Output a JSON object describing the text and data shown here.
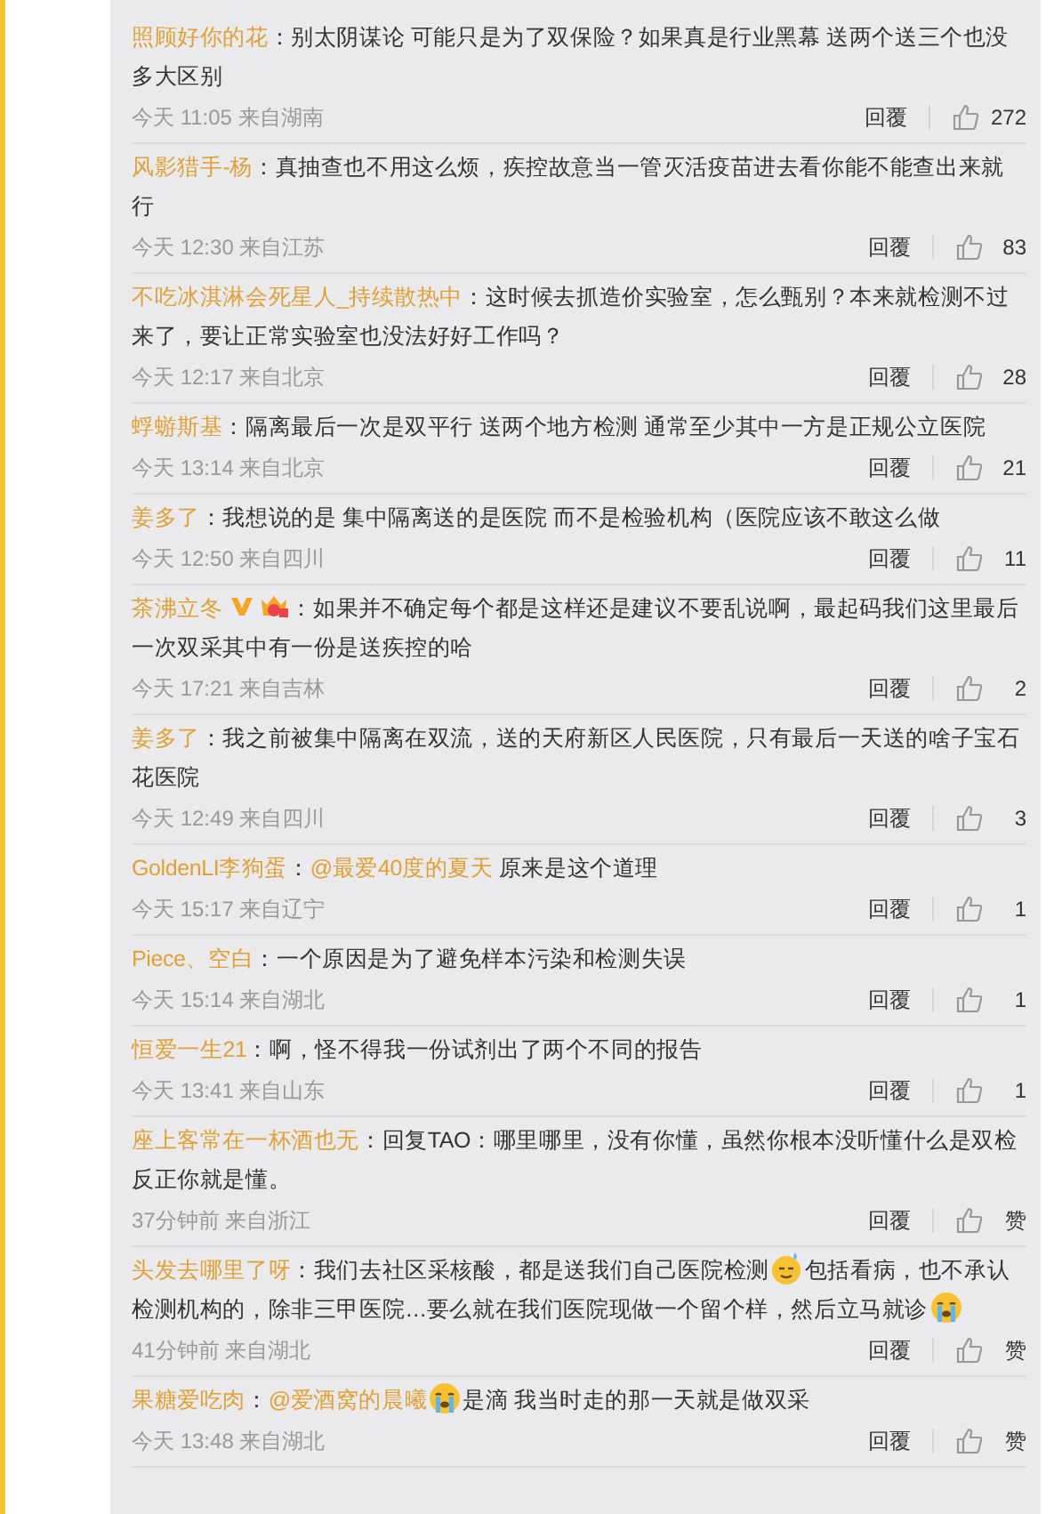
{
  "comments": [
    {
      "name": "照顾好你的花",
      "body": [
        {
          "kind": "text",
          "text": "：别太阴谋论 可能只是为了双保险？如果真是行业黑幕 送两个送三个也没多大区别"
        }
      ],
      "meta": "今天 11:05 来自湖南",
      "reply": "回覆",
      "likes": "272"
    },
    {
      "name": "风影猎手-杨",
      "body": [
        {
          "kind": "text",
          "text": "：真抽查也不用这么烦，疾控故意当一管灭活疫苗进去看你能不能查出来就行"
        }
      ],
      "meta": "今天 12:30 来自江苏",
      "reply": "回覆",
      "likes": "83"
    },
    {
      "name": "不吃冰淇淋会死星人_持续散热中",
      "body": [
        {
          "kind": "text",
          "text": "：这时候去抓造价实验室，怎么甄别？本来就检测不过来了，要让正常实验室也没法好好工作吗？"
        }
      ],
      "meta": "今天 12:17 来自北京",
      "reply": "回覆",
      "likes": "28"
    },
    {
      "name": "蜉蝣斯基",
      "body": [
        {
          "kind": "text",
          "text": "：隔离最后一次是双平行 送两个地方检测 通常至少其中一方是正规公立医院"
        }
      ],
      "meta": "今天 13:14 来自北京",
      "reply": "回覆",
      "likes": "21"
    },
    {
      "name": "姜多了",
      "body": [
        {
          "kind": "text",
          "text": "：我想说的是 集中隔离送的是医院 而不是检验机构（医院应该不敢这么做"
        }
      ],
      "meta": "今天 12:50 来自四川",
      "reply": "回覆",
      "likes": "11"
    },
    {
      "name": "茶沸立冬",
      "badges": [
        {
          "kind": "verified"
        },
        {
          "kind": "crown"
        }
      ],
      "body": [
        {
          "kind": "text",
          "text": "：如果并不确定每个都是这样还是建议不要乱说啊，最起码我们这里最后一次双采其中有一份是送疾控的哈"
        }
      ],
      "meta": "今天 17:21 来自吉林",
      "reply": "回覆",
      "likes": "2"
    },
    {
      "name": "姜多了",
      "body": [
        {
          "kind": "text",
          "text": "：我之前被集中隔离在双流，送的天府新区人民医院，只有最后一天送的啥子宝石花医院"
        }
      ],
      "meta": "今天 12:49 来自四川",
      "reply": "回覆",
      "likes": "3"
    },
    {
      "name": "GoldenLI李狗蛋",
      "body": [
        {
          "kind": "text",
          "text": "："
        },
        {
          "kind": "mention",
          "text": "@最爱40度的夏天"
        },
        {
          "kind": "text",
          "text": " 原来是这个道理"
        }
      ],
      "meta": "今天 15:17 来自辽宁",
      "reply": "回覆",
      "likes": "1"
    },
    {
      "name": "Piece、空白",
      "body": [
        {
          "kind": "text",
          "text": "：一个原因是为了避免样本污染和检测失误"
        }
      ],
      "meta": "今天 15:14 来自湖北",
      "reply": "回覆",
      "likes": "1"
    },
    {
      "name": "恒爱一生21",
      "body": [
        {
          "kind": "text",
          "text": "：啊，怪不得我一份试剂出了两个不同的报告"
        }
      ],
      "meta": "今天 13:41 来自山东",
      "reply": "回覆",
      "likes": "1"
    },
    {
      "name": "座上客常在一杯酒也无",
      "body": [
        {
          "kind": "text",
          "text": "：回复TAO：哪里哪里，没有你懂，虽然你根本没听懂什么是双检反正你就是懂。"
        }
      ],
      "meta": "37分钟前 来自浙江",
      "reply": "回覆",
      "likes": "赞"
    },
    {
      "name": "头发去哪里了呀",
      "body": [
        {
          "kind": "text",
          "text": "：我们去社区采核酸，都是送我们自己医院检测"
        },
        {
          "kind": "sweat_emoji"
        },
        {
          "kind": "text",
          "text": "包括看病，也不承认检测机构的，除非三甲医院…要么就在我们医院现做一个留个样，然后立马就诊"
        },
        {
          "kind": "crying_emoji"
        }
      ],
      "meta": "41分钟前 来自湖北",
      "reply": "回覆",
      "likes": "赞"
    },
    {
      "name": "果糖爱吃肉",
      "body": [
        {
          "kind": "text",
          "text": "："
        },
        {
          "kind": "mention",
          "text": "@爱酒窝的晨曦"
        },
        {
          "kind": "crying_emoji"
        },
        {
          "kind": "text",
          "text": "是滴 我当时走的那一天就是做双采"
        }
      ],
      "meta": "今天 13:48 来自湖北",
      "reply": "回覆",
      "likes": "赞"
    }
  ]
}
